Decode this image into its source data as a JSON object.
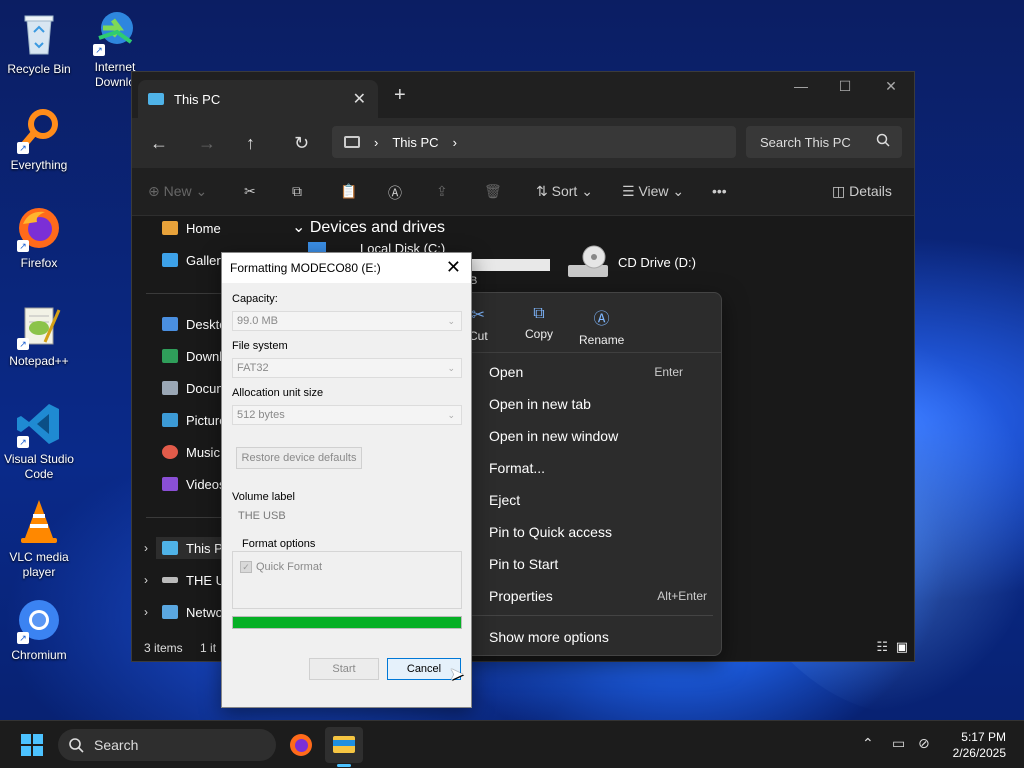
{
  "desktop": {
    "icons": [
      {
        "label": "Recycle Bin",
        "icon": "recycle-bin-icon"
      },
      {
        "label": "Internet Downlo",
        "icon": "idm-icon"
      },
      {
        "label": "Everything",
        "icon": "everything-search-icon"
      },
      {
        "label": "Firefox",
        "icon": "firefox-icon"
      },
      {
        "label": "Notepad++",
        "icon": "notepadpp-icon"
      },
      {
        "label": "Visual Studio Code",
        "icon": "vscode-icon"
      },
      {
        "label": "VLC media player",
        "icon": "vlc-icon"
      },
      {
        "label": "Chromium",
        "icon": "chromium-icon"
      }
    ]
  },
  "explorer": {
    "tab_title": "This PC",
    "tab_close": "✕",
    "new_tab": "+",
    "address": {
      "segment": "This PC"
    },
    "search_placeholder": "Search This PC",
    "toolbar": {
      "new_label": "New",
      "sort_label": "Sort",
      "view_label": "View",
      "more": "•••",
      "details_label": "Details"
    },
    "nav": {
      "home": "Home",
      "gallery": "Gallery",
      "desktop": "Deskto",
      "downloads": "Downl",
      "documents": "Docum",
      "pictures": "Picture",
      "music": "Music",
      "videos": "Videos",
      "this_pc": "This PC",
      "usb": "THE US",
      "network": "Netwo"
    },
    "group_heading": "Devices and drives",
    "drives": {
      "local": "Local Disk (C:)",
      "local_tail": "B",
      "cd": "CD Drive (D:)"
    },
    "status": {
      "items": "3 items",
      "selected": "1 it"
    }
  },
  "context_menu": {
    "tools": [
      {
        "label": "Cut",
        "icon": "scissors-icon"
      },
      {
        "label": "Copy",
        "icon": "copy-icon"
      },
      {
        "label": "Rename",
        "icon": "rename-icon"
      }
    ],
    "items": [
      {
        "label": "Open",
        "shortcut": "Enter"
      },
      {
        "label": "Open in new tab",
        "shortcut": ""
      },
      {
        "label": "Open in new window",
        "shortcut": ""
      },
      {
        "label": "Format...",
        "shortcut": ""
      },
      {
        "label": "Eject",
        "shortcut": ""
      },
      {
        "label": "Pin to Quick access",
        "shortcut": ""
      },
      {
        "label": "Pin to Start",
        "shortcut": ""
      },
      {
        "label": "Properties",
        "shortcut": "Alt+Enter"
      }
    ],
    "more_options": "Show more options"
  },
  "format_dialog": {
    "title": "Formatting MODECO80 (E:)",
    "capacity_label": "Capacity:",
    "capacity_value": "99.0 MB",
    "filesystem_label": "File system",
    "filesystem_value": "FAT32",
    "alloc_label": "Allocation unit size",
    "alloc_value": "512 bytes",
    "restore_button": "Restore device defaults",
    "volume_label": "Volume label",
    "volume_value": "THE USB",
    "format_options_label": "Format options",
    "quick_format_label": "Quick Format",
    "quick_format_checked": true,
    "progress_fraction": 1.0,
    "start_button": "Start",
    "cancel_button": "Cancel"
  },
  "taskbar": {
    "search_label": "Search",
    "time": "5:17 PM",
    "date": "2/26/2025"
  },
  "colors": {
    "accent": "#0078d7",
    "progress": "#06b025",
    "start": "#4cc2ff"
  }
}
